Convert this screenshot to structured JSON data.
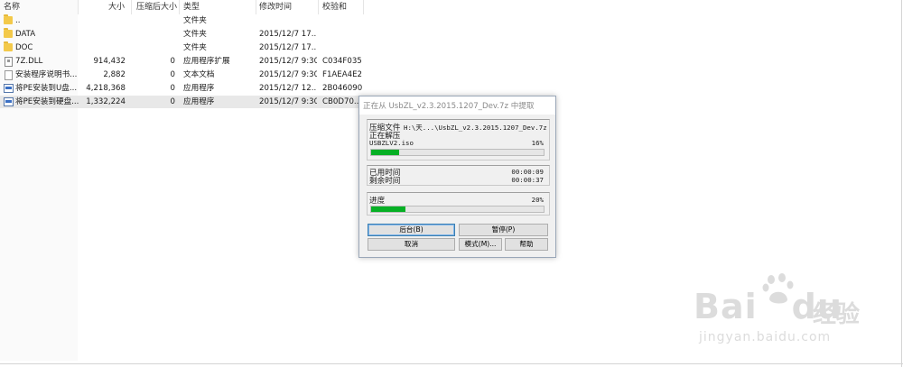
{
  "columns": {
    "name": "名称",
    "size": "大小",
    "packed": "压缩后大小",
    "type": "类型",
    "modified": "修改时间",
    "crc": "校验和"
  },
  "files": [
    {
      "name": "..",
      "size": "",
      "packed": "",
      "type": "文件夹",
      "modified": "",
      "crc": "",
      "icon": "folder-icon"
    },
    {
      "name": "DATA",
      "size": "",
      "packed": "",
      "type": "文件夹",
      "modified": "2015/12/7 17...",
      "crc": "",
      "icon": "folder-icon"
    },
    {
      "name": "DOC",
      "size": "",
      "packed": "",
      "type": "文件夹",
      "modified": "2015/12/7 17...",
      "crc": "",
      "icon": "folder-icon"
    },
    {
      "name": "7Z.DLL",
      "size": "914,432",
      "packed": "0",
      "type": "应用程序扩展",
      "modified": "2015/12/7 9:30",
      "crc": "C034F035",
      "icon": "dll-icon"
    },
    {
      "name": "安装程序说明书...",
      "size": "2,882",
      "packed": "0",
      "type": "文本文档",
      "modified": "2015/12/7 9:30",
      "crc": "F1AEA4E2",
      "icon": "text-file-icon"
    },
    {
      "name": "将PE安装到U盘...",
      "size": "4,218,368",
      "packed": "0",
      "type": "应用程序",
      "modified": "2015/12/7 12...",
      "crc": "2B046090",
      "icon": "exe-icon"
    },
    {
      "name": "将PE安装到硬盘...",
      "size": "1,332,224",
      "packed": "0",
      "type": "应用程序",
      "modified": "2015/12/7 9:30",
      "crc": "CB0D70...",
      "icon": "exe-icon"
    }
  ],
  "dialog": {
    "title": "正在从 UsbZL_v2.3.2015.1207_Dev.7z 中提取",
    "archive_label": "压缩文件",
    "archive_path": "H:\\天...\\UsbZL_v2.3.2015.1207_Dev.7z",
    "status": "正在解压",
    "current_file": "USBZLV2.iso",
    "file_percent": "16%",
    "file_progress": 0.16,
    "elapsed_label": "已用时间",
    "elapsed": "00:00:09",
    "remaining_label": "剩余时间",
    "remaining": "00:00:37",
    "progress_label": "进度",
    "total_percent": "20%",
    "total_progress": 0.2,
    "btn_background": "后台(B)",
    "btn_pause": "暂停(P)",
    "btn_cancel": "取消",
    "btn_mode": "模式(M)...",
    "btn_help": "帮助"
  },
  "watermark": {
    "brand": "Bai",
    "brand2": "du",
    "cn": "经验",
    "url": "jingyan.baidu.com"
  },
  "colors": {
    "progress": "#06b025",
    "folder": "#f3c94a",
    "selection": "#e8e8e8"
  }
}
